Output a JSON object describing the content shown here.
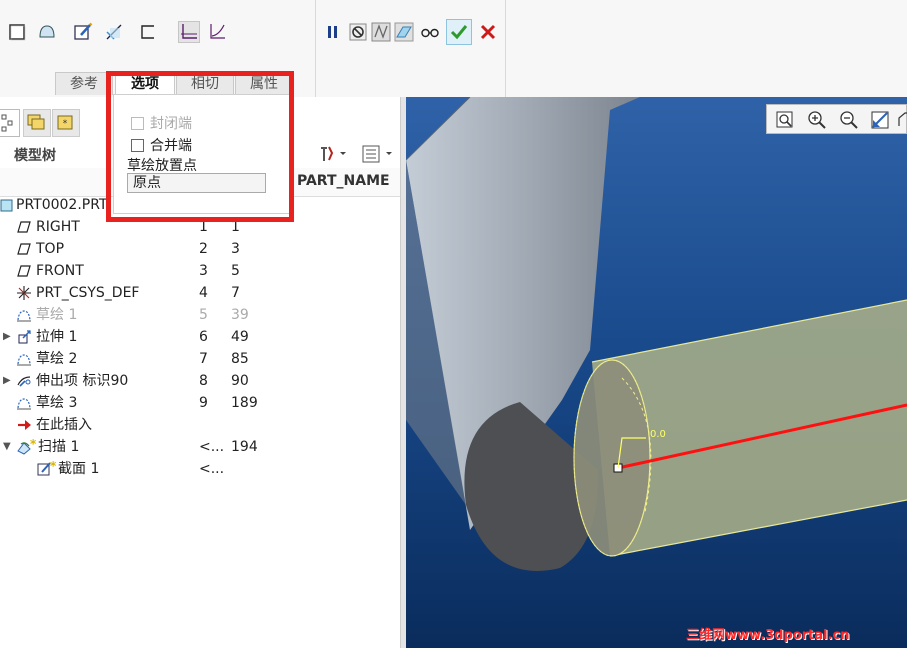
{
  "ribbon": {
    "tabs": [
      {
        "label": "参考",
        "active": false
      },
      {
        "label": "选项",
        "active": true
      },
      {
        "label": "相切",
        "active": false
      },
      {
        "label": "属性",
        "active": false
      }
    ],
    "tool_icons": [
      "box-icon",
      "surface-icon",
      "edit-section-icon",
      "trim-icon",
      "open-section-icon",
      "horizontal-icon",
      "curve-icon"
    ],
    "action_icons": [
      "pause-icon",
      "no-preview-icon",
      "verify-icon",
      "preview-icon",
      "glasses-icon",
      "ok-icon",
      "cancel-icon"
    ]
  },
  "options_panel": {
    "closed_end_label": "封闭端",
    "closed_end_checked": false,
    "closed_end_disabled": true,
    "merge_end_label": "合并端",
    "merge_end_checked": false,
    "placement_label": "草绘放置点",
    "placement_value": "原点"
  },
  "model_tree": {
    "title": "模型树",
    "column_header": "PART_NAME",
    "root": "PRT0002.PRT",
    "items": [
      {
        "name": "RIGHT",
        "c1": "1",
        "c2": "1",
        "icon": "datum-plane-icon"
      },
      {
        "name": "TOP",
        "c1": "2",
        "c2": "3",
        "icon": "datum-plane-icon"
      },
      {
        "name": "FRONT",
        "c1": "3",
        "c2": "5",
        "icon": "datum-plane-icon"
      },
      {
        "name": "PRT_CSYS_DEF",
        "c1": "4",
        "c2": "7",
        "icon": "csys-icon"
      },
      {
        "name": "草绘 1",
        "c1": "5",
        "c2": "39",
        "icon": "sketch-icon",
        "gray": true
      },
      {
        "name": "拉伸 1",
        "c1": "6",
        "c2": "49",
        "icon": "extrude-icon",
        "expand": true
      },
      {
        "name": "草绘 2",
        "c1": "7",
        "c2": "85",
        "icon": "sketch-icon"
      },
      {
        "name": "伸出项 标识90",
        "c1": "8",
        "c2": "90",
        "icon": "protrusion-icon",
        "expand": true
      },
      {
        "name": "草绘 3",
        "c1": "9",
        "c2": "189",
        "icon": "sketch-icon"
      },
      {
        "name": "在此插入",
        "c1": "",
        "c2": "",
        "icon": "insert-arrow-icon"
      },
      {
        "name": "扫描 1",
        "c1": "<...",
        "c2": "194",
        "icon": "sweep-icon",
        "expand": true,
        "expanded": true,
        "star": true
      },
      {
        "name": "截面 1",
        "c1": "<...",
        "c2": "",
        "icon": "section-icon",
        "star": true,
        "child": true
      }
    ]
  },
  "viewport": {
    "dimension_label": "0.0",
    "view_icons": [
      "refit-icon",
      "zoom-in-icon",
      "zoom-out-icon",
      "repaint-icon",
      "saved-views-icon"
    ]
  },
  "watermark": "三维网www.3dportal.cn",
  "colors": {
    "accent_red": "#e8231f",
    "ok_green": "#2e9a2e",
    "viewport_blue": "#194a8c",
    "trajectory_red": "#ff1010",
    "sketch_yellow": "#ffff66"
  }
}
